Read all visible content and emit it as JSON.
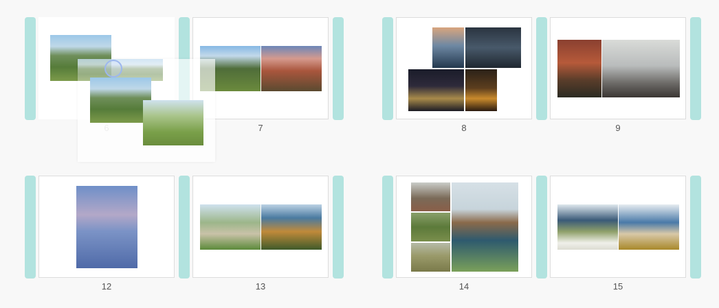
{
  "pages": [
    {
      "number": "6"
    },
    {
      "number": "7"
    },
    {
      "number": "8"
    },
    {
      "number": "9"
    },
    {
      "number": "12"
    },
    {
      "number": "13"
    },
    {
      "number": "14"
    },
    {
      "number": "15"
    }
  ],
  "colors": {
    "handle": "#b2e3df",
    "page_border": "#dcdcdc",
    "background": "#f8f8f8",
    "cursor": "#9db7ee"
  }
}
